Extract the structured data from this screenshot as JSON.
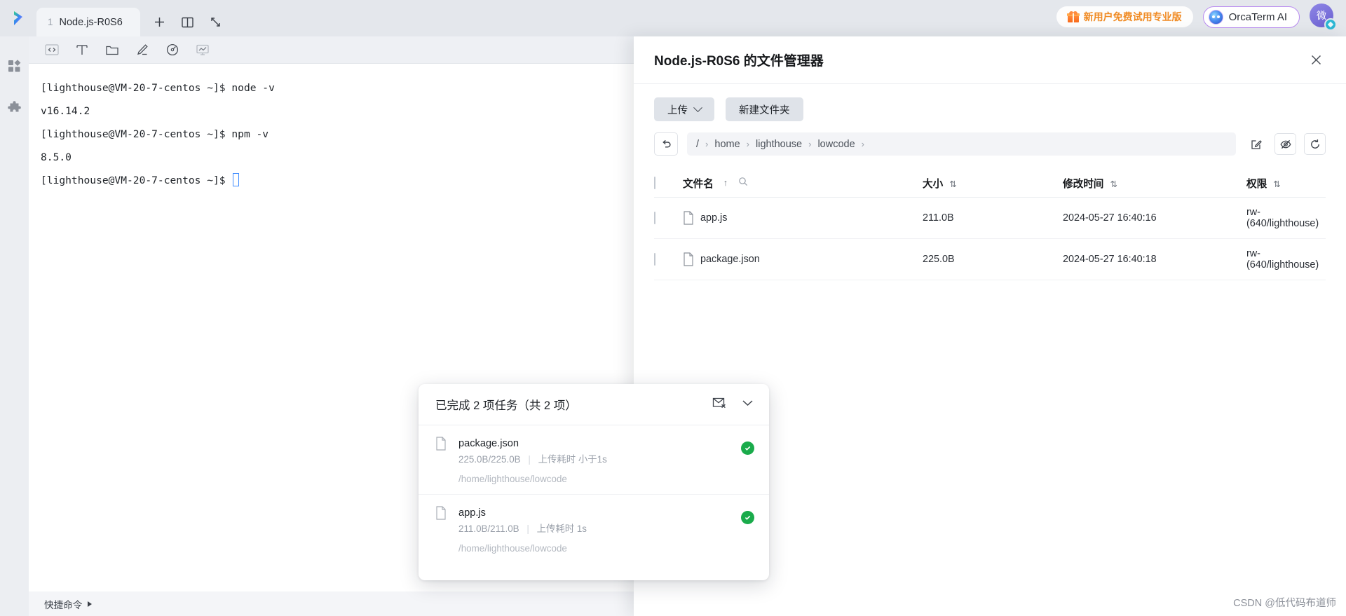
{
  "topbar": {
    "tab": {
      "index": "1",
      "label": "Node.js-R0S6"
    },
    "controls": [
      {
        "name": "new-tab-button",
        "glyph": "+"
      },
      {
        "name": "split-pane-button",
        "glyph": "split"
      },
      {
        "name": "fullscreen-button",
        "glyph": "expand"
      }
    ],
    "promo_label": "新用户免费试用专业版",
    "ai_label": "OrcaTerm AI",
    "avatar_text": "微"
  },
  "rail": {
    "items": [
      {
        "name": "apps-grid-icon",
        "label": "应用"
      },
      {
        "name": "puzzle-plugin-icon",
        "label": "插件"
      }
    ]
  },
  "terminal": {
    "toolbar": [
      {
        "name": "code-icon"
      },
      {
        "name": "text-format-icon"
      },
      {
        "name": "folder-icon"
      },
      {
        "name": "edit-pencil-icon"
      },
      {
        "name": "gauge-monitor-icon"
      },
      {
        "name": "screen-chart-icon"
      }
    ],
    "lines": [
      "[lighthouse@VM-20-7-centos ~]$ node -v",
      "v16.14.2",
      "[lighthouse@VM-20-7-centos ~]$ npm -v",
      "8.5.0"
    ],
    "prompt": "[lighthouse@VM-20-7-centos ~]$ ",
    "footer_label": "快捷命令"
  },
  "file_manager": {
    "title": "Node.js-R0S6 的文件管理器",
    "upload_button": "上传",
    "new_folder_button": "新建文件夹",
    "breadcrumb": [
      "/",
      "home",
      "lighthouse",
      "lowcode"
    ],
    "breadcrumb_sep": "›",
    "tools": [
      {
        "name": "edit-path-icon"
      },
      {
        "name": "hidden-files-eye-icon"
      },
      {
        "name": "refresh-icon"
      }
    ],
    "columns": {
      "name": "文件名",
      "size": "大小",
      "mtime": "修改时间",
      "perm": "权限",
      "sort_asc": "↑",
      "sort_both": "⇅"
    },
    "rows": [
      {
        "name": "app.js",
        "size": "211.0B",
        "mtime": "2024-05-27 16:40:16",
        "perm": "rw-  (640/lighthouse)"
      },
      {
        "name": "package.json",
        "size": "225.0B",
        "mtime": "2024-05-27 16:40:18",
        "perm": "rw-  (640/lighthouse)"
      }
    ]
  },
  "upload_popup": {
    "title": "已完成 2 项任务（共 2 项）",
    "items": [
      {
        "name": "package.json",
        "progress": "225.0B/225.0B",
        "duration": "上传耗时 小于1s",
        "path": "/home/lighthouse/lowcode",
        "status": "success"
      },
      {
        "name": "app.js",
        "progress": "211.0B/211.0B",
        "duration": "上传耗时 1s",
        "path": "/home/lighthouse/lowcode",
        "status": "success"
      }
    ]
  },
  "watermark": "CSDN @低代码布道师",
  "colors": {
    "accent_purple": "#b98bf0",
    "promo_orange": "#f08a22",
    "success_green": "#1aab4b",
    "cursor_blue": "#3f8cff"
  }
}
